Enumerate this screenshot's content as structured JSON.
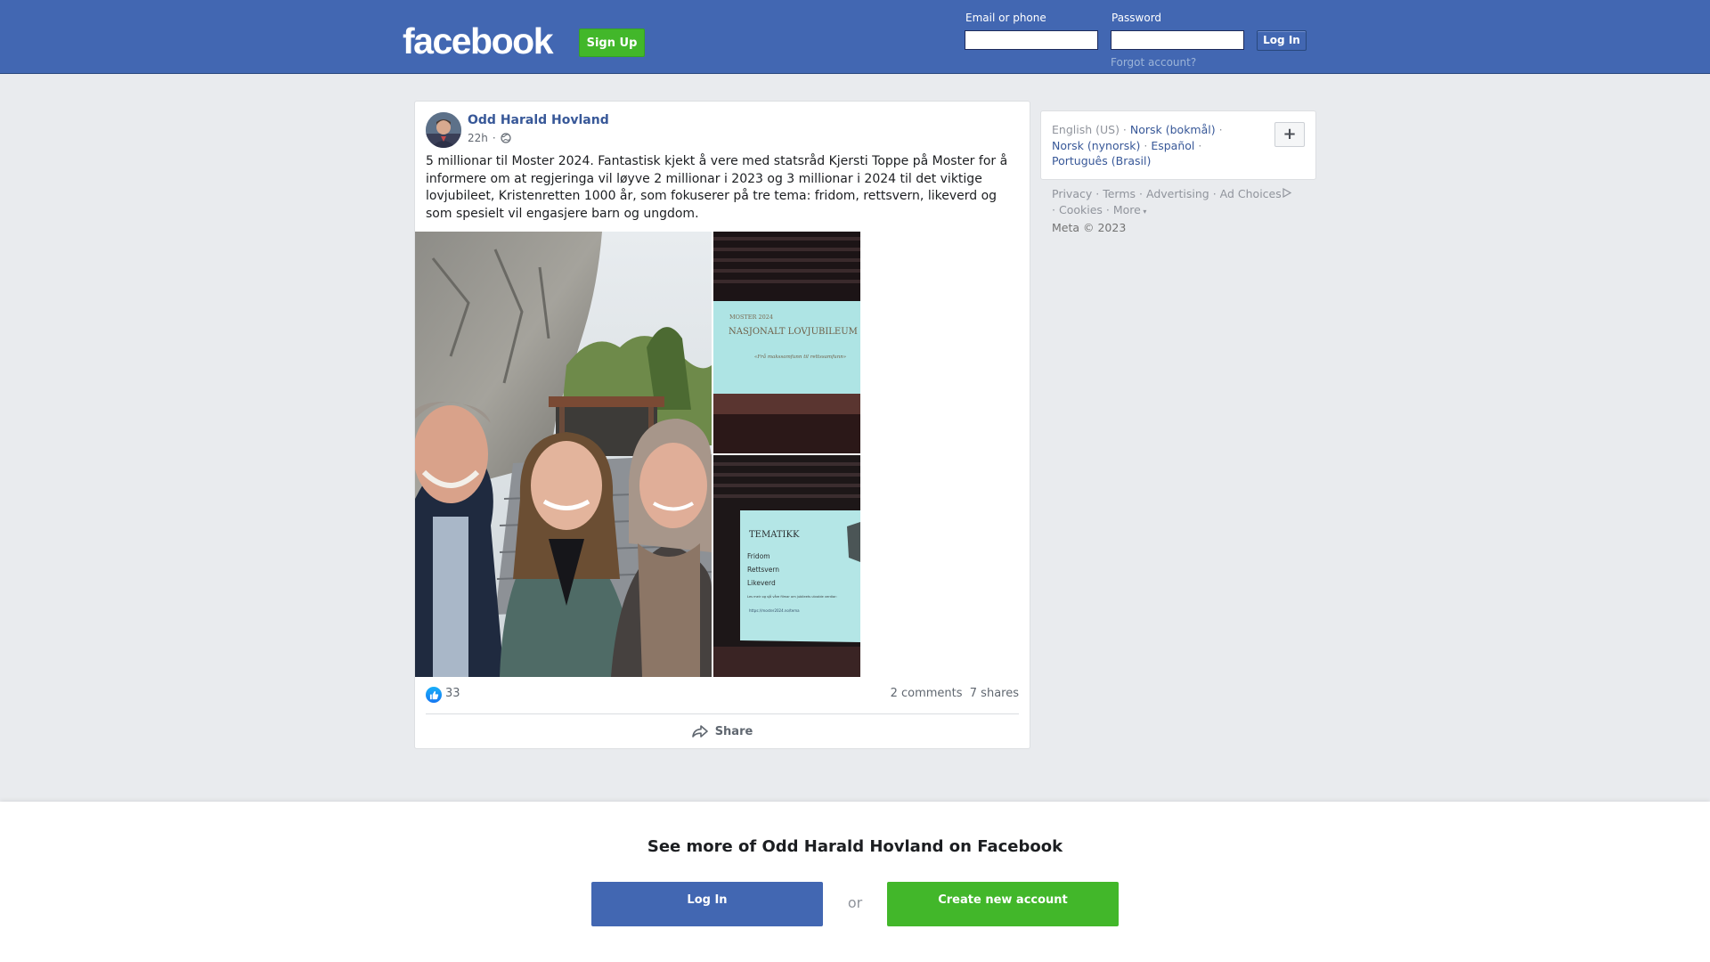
{
  "header": {
    "logo_text": "facebook",
    "signup_label": "Sign Up",
    "email_label": "Email or phone",
    "password_label": "Password",
    "login_label": "Log In",
    "forgot_label": "Forgot account?",
    "brand_color": "#4267b2",
    "green_color": "#42b72a"
  },
  "post": {
    "author": "Odd Harald Hovland",
    "time": "22h",
    "privacy_icon": "globe-icon",
    "text": "5 millionar til Moster 2024. Fantastisk kjekt å vere med statsråd Kjersti Toppe på Moster for å informere om at regjeringa vil løyve 2 millionar i 2023 og 3 millionar i 2024 til det viktige lovjubileet, Kristenretten 1000 år, som fokuserer på tre tema: fridom, rettsvern, likeverd og som spesielt vil engasjere barn og ungdom.",
    "photo1_desc": "selfie-three-people-outdoors",
    "photo2": {
      "small_title": "MOSTER 2024",
      "title": "NASJONALT LOVJUBILEUM",
      "subtitle": "«Frå makssamfunn til rettssamfunn»"
    },
    "photo3": {
      "title": "TEMATIKK",
      "items": [
        "Fridom",
        "Rettsvern",
        "Likeverd"
      ],
      "note": "Les meir og sjå våre filmar om jubileets utvalde verdiar:",
      "link": "https://moster2024.no/tema"
    },
    "reactions_count": "33",
    "comments": "2 comments",
    "shares": "7 shares",
    "share_label": "Share"
  },
  "sidebar": {
    "lang_current": "English (US)",
    "lang_norsk_bokmal": "Norsk (bokmål)",
    "lang_norsk_nynorsk": "Norsk (nynorsk)",
    "lang_espanol": "Español",
    "lang_portugues": "Português (Brasil)",
    "plus_label": "+",
    "footer": {
      "privacy": "Privacy",
      "terms": "Terms",
      "advertising": "Advertising",
      "ad_choices": "Ad Choices",
      "cookies": "Cookies",
      "more": "More",
      "copyright": "Meta © 2023"
    }
  },
  "banner": {
    "title": "See more of Odd Harald Hovland on Facebook",
    "login_label": "Log In",
    "or_label": "or",
    "create_label": "Create new account"
  }
}
